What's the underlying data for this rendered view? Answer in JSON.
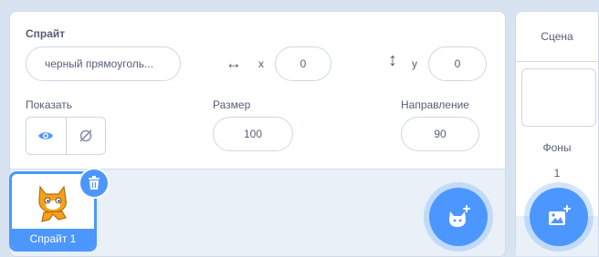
{
  "sprite_info": {
    "sprite_label": "Спрайт",
    "sprite_name": "черный прямоуголь...",
    "x_label": "x",
    "x_value": "0",
    "y_label": "y",
    "y_value": "0",
    "show_label": "Показать",
    "size_label": "Размер",
    "size_value": "100",
    "direction_label": "Направление",
    "direction_value": "90"
  },
  "sprite_list": {
    "items": [
      {
        "name": "Спрайт 1",
        "selected": true
      }
    ]
  },
  "stage_panel": {
    "title": "Сцена",
    "backdrops_label": "Фоны",
    "backdrops_count": "1"
  },
  "colors": {
    "accent": "#4c97ff",
    "panel_bg": "#e9f0f8",
    "text": "#575e75"
  },
  "icons": {
    "x_axis": "horizontal-arrows-icon",
    "y_axis": "vertical-arrows-icon",
    "show": "eye-icon",
    "hide": "eye-slash-icon",
    "delete": "trash-icon",
    "choose_sprite": "cat-plus-icon",
    "choose_backdrop": "image-plus-icon"
  }
}
